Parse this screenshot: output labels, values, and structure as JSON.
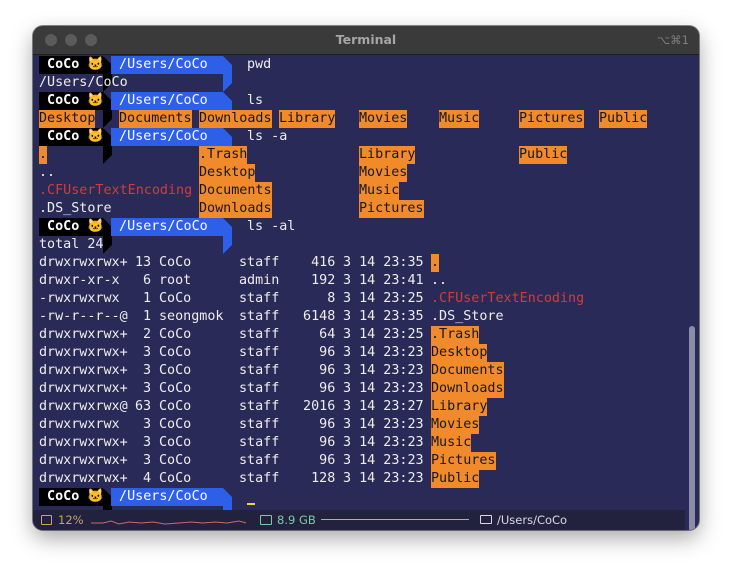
{
  "window": {
    "title": "Terminal",
    "shortcut": "⌥⌘1"
  },
  "prompt": {
    "user": "CoCo",
    "emoji": "🐱",
    "path": "/Users/CoCo"
  },
  "commands": {
    "c1": "pwd",
    "c2": "ls",
    "c3": "ls -a",
    "c4": "ls -al"
  },
  "pwd_output": "/Users/CoCo",
  "ls": [
    "Desktop",
    "Documents",
    "Downloads",
    "Library",
    "Movies",
    "Music",
    "Pictures",
    "Public"
  ],
  "ls_a": {
    "col1": [
      ".",
      "..",
      ".CFUserTextEncoding",
      ".DS_Store"
    ],
    "col2": [
      ".Trash",
      "Desktop",
      "Documents",
      "Downloads"
    ],
    "col3": [
      "Library",
      "Movies",
      "Music",
      "Pictures"
    ],
    "col4": [
      "Public"
    ]
  },
  "ls_al": {
    "total": "total 24",
    "rows": [
      [
        "drwxrwxrwx+",
        "13",
        "CoCo",
        "staff",
        "416",
        "3 14 23:35",
        "."
      ],
      [
        "drwxr-xr-x",
        "6",
        "root",
        "admin",
        "192",
        "3 14 23:41",
        ".."
      ],
      [
        "-rwxrwxrwx",
        "1",
        "CoCo",
        "staff",
        "8",
        "3 14 23:25",
        ".CFUserTextEncoding"
      ],
      [
        "-rw-r--r--@",
        "1",
        "seongmok",
        "staff",
        "6148",
        "3 14 23:35",
        ".DS_Store"
      ],
      [
        "drwxrwxrwx+",
        "2",
        "CoCo",
        "staff",
        "64",
        "3 14 23:25",
        ".Trash"
      ],
      [
        "drwxrwxrwx+",
        "3",
        "CoCo",
        "staff",
        "96",
        "3 14 23:23",
        "Desktop"
      ],
      [
        "drwxrwxrwx+",
        "3",
        "CoCo",
        "staff",
        "96",
        "3 14 23:23",
        "Documents"
      ],
      [
        "drwxrwxrwx+",
        "3",
        "CoCo",
        "staff",
        "96",
        "3 14 23:23",
        "Downloads"
      ],
      [
        "drwxrwxrwx@",
        "63",
        "CoCo",
        "staff",
        "2016",
        "3 14 23:27",
        "Library"
      ],
      [
        "drwxrwxrwx",
        "3",
        "CoCo",
        "staff",
        "96",
        "3 14 23:23",
        "Movies"
      ],
      [
        "drwxrwxrwx+",
        "3",
        "CoCo",
        "staff",
        "96",
        "3 14 23:23",
        "Music"
      ],
      [
        "drwxrwxrwx+",
        "3",
        "CoCo",
        "staff",
        "96",
        "3 14 23:23",
        "Pictures"
      ],
      [
        "drwxrwxrwx+",
        "4",
        "CoCo",
        "staff",
        "128",
        "3 14 23:23",
        "Public"
      ]
    ]
  },
  "statusbar": {
    "cpu_label": "12%",
    "memory_label": "8.9 GB",
    "path_label": "/Users/CoCo"
  },
  "colors": {
    "terminal_bg": "#2a2a58",
    "highlight": "#f18a2b",
    "path_segment": "#2d5fe8",
    "user_segment": "#000000",
    "error_text": "#d23b3b"
  }
}
